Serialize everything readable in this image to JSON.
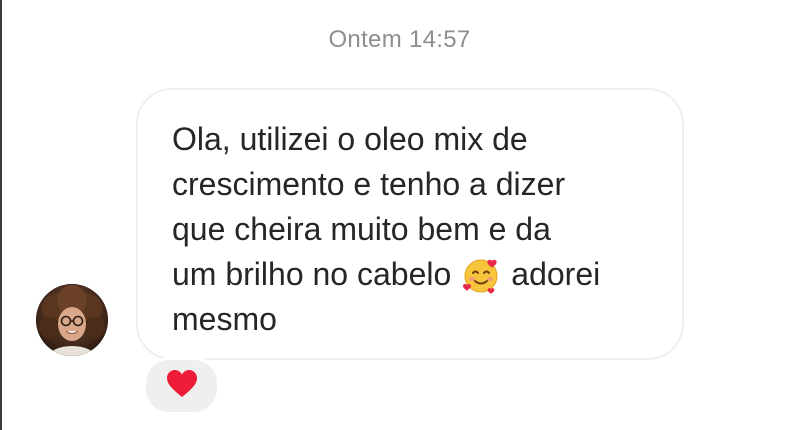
{
  "timestamp": "Ontem 14:57",
  "message": {
    "lines": [
      "Ola, utilizei o oleo mix de",
      "crescimento e tenho a dizer",
      "que cheira muito bem e da",
      "um brilho no cabelo",
      "mesmo"
    ],
    "line4_suffix": "adorei",
    "emoji": "smiling-face-with-hearts"
  },
  "reaction": {
    "emoji": "red-heart",
    "color": "#ee1d37"
  },
  "colors": {
    "bubble_border": "#efefef",
    "text": "#262626",
    "timestamp": "#8e8e8e",
    "reaction_bg": "#efefef"
  }
}
